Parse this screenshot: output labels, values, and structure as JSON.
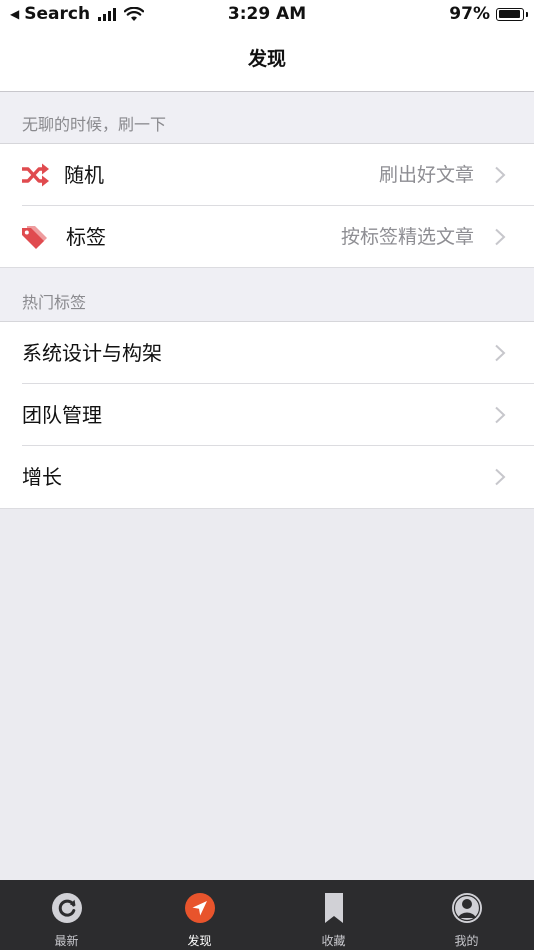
{
  "status_bar": {
    "back_label": "Search",
    "time": "3:29 AM",
    "battery": "97%",
    "battery_level": 0.97
  },
  "nav": {
    "title": "发现"
  },
  "sections": [
    {
      "header": "无聊的时候，刷一下",
      "rows": [
        {
          "label": "随机",
          "detail": "刷出好文章",
          "icon": "shuffle-icon"
        },
        {
          "label": "标签",
          "detail": "按标签精选文章",
          "icon": "tag-icon"
        }
      ]
    },
    {
      "header": "热门标签",
      "rows": [
        {
          "label": "系统设计与构架"
        },
        {
          "label": "团队管理"
        },
        {
          "label": "增长"
        }
      ]
    }
  ],
  "tabs": [
    {
      "label": "最新",
      "icon": "refresh-icon",
      "active": false
    },
    {
      "label": "发现",
      "icon": "compass-icon",
      "active": true
    },
    {
      "label": "收藏",
      "icon": "bookmark-icon",
      "active": false
    },
    {
      "label": "我的",
      "icon": "profile-icon",
      "active": false
    }
  ],
  "colors": {
    "accent": "#e04b4f",
    "tab_active": "#e8542c",
    "tab_bar_bg": "#2c2c2e",
    "page_bg": "#ebebf0"
  }
}
